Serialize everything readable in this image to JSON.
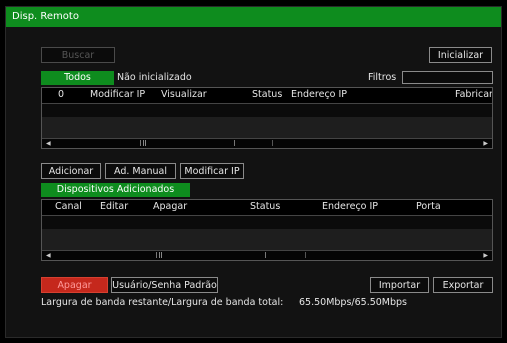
{
  "window": {
    "title": "Disp. Remoto"
  },
  "toolbar": {
    "search_label": "Buscar",
    "initialize_label": "Inicializar"
  },
  "filter": {
    "tab_all": "Todos",
    "tab_uninitialized": "Não inicializado",
    "filter_label": "Filtros",
    "filter_value": ""
  },
  "found_table": {
    "columns": [
      "0",
      "Modificar IP",
      "Visualizar",
      "Status",
      "Endereço IP",
      "Fabricant"
    ]
  },
  "device_buttons": {
    "add": "Adicionar",
    "manual_add": "Ad. Manual",
    "modify_ip": "Modificar IP"
  },
  "added_tab": {
    "label": "Dispositivos Adicionados"
  },
  "added_table": {
    "columns": [
      "Canal",
      "Editar",
      "Apagar",
      "Status",
      "Endereço IP",
      "Porta"
    ]
  },
  "bottom": {
    "delete": "Apagar",
    "default_credentials": "Usuário/Senha Padrão",
    "import": "Importar",
    "export": "Exportar",
    "bandwidth_label": "Largura de banda restante/Largura de banda total:",
    "bandwidth_value": "65.50Mbps/65.50Mbps"
  },
  "colors": {
    "accent": "#0e8c1e",
    "danger": "#c5281c",
    "background": "#121212"
  }
}
